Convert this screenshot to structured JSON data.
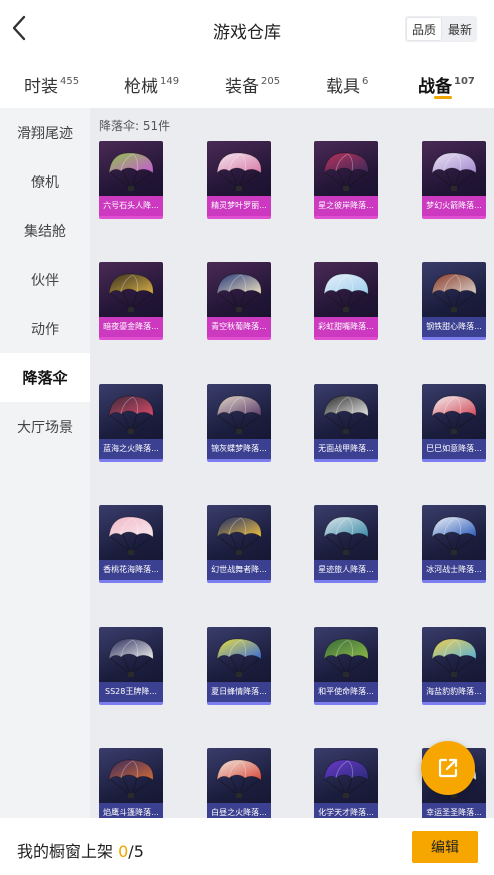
{
  "header": {
    "title": "游戏仓库",
    "sort": [
      "品质",
      "最新"
    ],
    "sort_active": 0
  },
  "tabs": [
    {
      "label": "时装",
      "count": "455"
    },
    {
      "label": "枪械",
      "count": "149"
    },
    {
      "label": "装备",
      "count": "205"
    },
    {
      "label": "载具",
      "count": "6"
    },
    {
      "label": "战备",
      "count": "107"
    }
  ],
  "active_tab": 4,
  "sidebar": {
    "items": [
      "滑翔尾迹",
      "僚机",
      "集结舱",
      "伙伴",
      "动作",
      "降落伞",
      "大厅场景"
    ],
    "active": 5
  },
  "content": {
    "count_text": "降落伞: 51件",
    "items": [
      {
        "name": "六号石头人降...",
        "rarity": "pink",
        "colors": [
          "#8ec24c",
          "#c85ad6"
        ]
      },
      {
        "name": "精灵梦叶罗丽...",
        "rarity": "pink",
        "colors": [
          "#f3e6ee",
          "#d87aa8"
        ]
      },
      {
        "name": "星之彼岸降落...",
        "rarity": "pink",
        "colors": [
          "#b8305a",
          "#3a2a5a"
        ]
      },
      {
        "name": "梦幻火箭降落...",
        "rarity": "pink",
        "colors": [
          "#e9e2f2",
          "#a58ad0"
        ]
      },
      {
        "name": "暗夜鎏金降落...",
        "rarity": "pink",
        "colors": [
          "#3a3020",
          "#d6b048"
        ]
      },
      {
        "name": "青空秋葡降落...",
        "rarity": "pink",
        "colors": [
          "#263a7a",
          "#f0e0c0"
        ]
      },
      {
        "name": "彩虹甜嘴降落...",
        "rarity": "pink",
        "colors": [
          "#e8eef8",
          "#9fd0ef"
        ]
      },
      {
        "name": "钢铁甜心降落...",
        "rarity": "blue",
        "colors": [
          "#8a3a2a",
          "#d8d0c8"
        ]
      },
      {
        "name": "蓝海之火降落...",
        "rarity": "blue",
        "colors": [
          "#3a2a3a",
          "#d84a6a"
        ]
      },
      {
        "name": "锦灰蝶梦降落...",
        "rarity": "blue",
        "colors": [
          "#e2d8c8",
          "#5a3a6a"
        ]
      },
      {
        "name": "无面战甲降落...",
        "rarity": "blue",
        "colors": [
          "#2a2a2a",
          "#e8e8e8"
        ]
      },
      {
        "name": "巳巳如意降落...",
        "rarity": "blue",
        "colors": [
          "#f4f0f0",
          "#d04a5a"
        ]
      },
      {
        "name": "香桃花海降落...",
        "rarity": "blue",
        "colors": [
          "#f0b8c8",
          "#f8e8ee"
        ]
      },
      {
        "name": "幻世战舞者降...",
        "rarity": "blue",
        "colors": [
          "#1a2a6a",
          "#f0c040"
        ]
      },
      {
        "name": "星迹旅人降落...",
        "rarity": "blue",
        "colors": [
          "#e0e8ec",
          "#3a8aa8"
        ]
      },
      {
        "name": "冰河战士降落...",
        "rarity": "blue",
        "colors": [
          "#f2f4f8",
          "#2a5ab8"
        ]
      },
      {
        "name": "SS28王牌降...",
        "rarity": "blue",
        "colors": [
          "#2a2a5a",
          "#f0f0f0"
        ]
      },
      {
        "name": "夏日蜂情降落...",
        "rarity": "blue",
        "colors": [
          "#e8e040",
          "#3a6ad8"
        ]
      },
      {
        "name": "和平使命降落...",
        "rarity": "blue",
        "colors": [
          "#3a6a3a",
          "#8ab84a"
        ]
      },
      {
        "name": "海盐豹豹降落...",
        "rarity": "blue",
        "colors": [
          "#f0d050",
          "#5ab0d8"
        ]
      },
      {
        "name": "焰鹰斗篷降落...",
        "rarity": "blue",
        "colors": [
          "#3a2a5a",
          "#d06a3a"
        ]
      },
      {
        "name": "白昼之火降落...",
        "rarity": "blue",
        "colors": [
          "#f0e8e0",
          "#d84a3a"
        ]
      },
      {
        "name": "化学天才降落...",
        "rarity": "blue",
        "colors": [
          "#6a3ac8",
          "#2a2a7a"
        ]
      },
      {
        "name": "幸运圣圣降落...",
        "rarity": "blue",
        "colors": [
          "#3a8ac0",
          "#f0f0f0"
        ]
      }
    ]
  },
  "footer": {
    "label": "我的橱窗上架",
    "current": "0",
    "separator": "/",
    "total": "5",
    "edit": "编辑"
  },
  "icons": {
    "back": "chevron-left-icon",
    "share": "share-external-icon"
  },
  "colors": {
    "accent": "#f7a600",
    "pink_rarity": "#e04fd0",
    "blue_rarity": "#7c7ef0"
  }
}
